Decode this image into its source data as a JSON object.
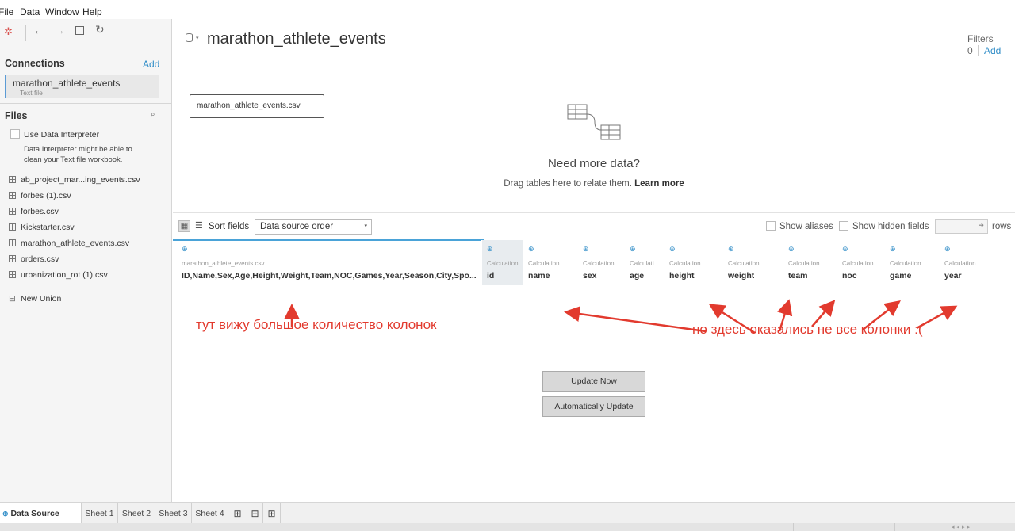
{
  "menu": [
    "File",
    "Data",
    "Window",
    "Help"
  ],
  "connections": {
    "heading": "Connections",
    "add_label": "Add",
    "item_name": "marathon_athlete_events",
    "item_type": "Text file"
  },
  "files": {
    "heading": "Files",
    "interpreter_label": "Use Data Interpreter",
    "interpreter_note_1": "Data Interpreter might be able to",
    "interpreter_note_2": "clean your Text file workbook.",
    "items": [
      "ab_project_mar...ing_events.csv",
      "forbes (1).csv",
      "forbes.csv",
      "Kickstarter.csv",
      "marathon_athlete_events.csv",
      "orders.csv",
      "urbanization_rot (1).csv"
    ],
    "new_union": "New Union"
  },
  "datasource": {
    "title": "marathon_athlete_events",
    "filters_label": "Filters",
    "filters_count": "0",
    "filters_add": "Add",
    "canvas_table": "marathon_athlete_events.csv",
    "need_more": "Need more data?",
    "drag_hint": "Drag tables here to relate them.",
    "learn_more": "Learn more"
  },
  "grid_toolbar": {
    "sort_label": "Sort fields",
    "sort_value": "Data source order",
    "show_aliases": "Show aliases",
    "show_hidden": "Show hidden fields",
    "rows_label": "rows"
  },
  "columns": [
    {
      "source": "marathon_athlete_events.csv",
      "name": "ID,Name,Sex,Age,Height,Weight,Team,NOC,Games,Year,Season,City,Spo..."
    },
    {
      "source": "Calculation",
      "name": "id"
    },
    {
      "source": "Calculation",
      "name": "name"
    },
    {
      "source": "Calculation",
      "name": "sex"
    },
    {
      "source": "Calculati...",
      "name": "age"
    },
    {
      "source": "Calculation",
      "name": "height"
    },
    {
      "source": "Calculation",
      "name": "weight"
    },
    {
      "source": "Calculation",
      "name": "team"
    },
    {
      "source": "Calculation",
      "name": "noc"
    },
    {
      "source": "Calculation",
      "name": "game"
    },
    {
      "source": "Calculation",
      "name": "year"
    }
  ],
  "buttons": {
    "update_now": "Update Now",
    "auto_update": "Automatically Update"
  },
  "annotations": {
    "left": "тут вижу большое количество колонок",
    "right": "но здесь оказались не все колонки :("
  },
  "sheet_tabs": [
    "Data Source",
    "Sheet 1",
    "Sheet 2",
    "Sheet 3",
    "Sheet 4"
  ],
  "colors": {
    "accent": "#2e8cc7",
    "annotation": "#e23a2e"
  }
}
